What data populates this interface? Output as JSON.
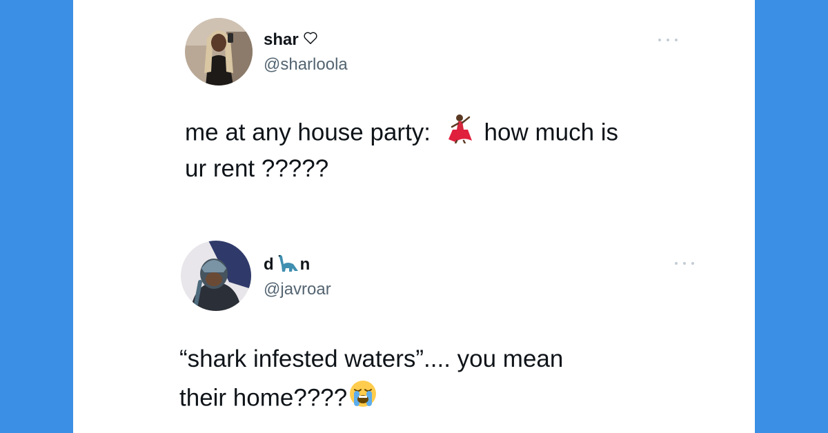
{
  "tweets": [
    {
      "display_name": "shar",
      "name_badge_icon": "heart-outline-icon",
      "handle": "@sharloola",
      "text_line1_before": "me at any house party:",
      "text_line1_emoji": "dancer-emoji",
      "text_line1_after": "how much is",
      "text_line2": "ur rent ?????"
    },
    {
      "display_name_start": "d",
      "display_name_emoji": "sauropod-emoji",
      "display_name_end": "n",
      "handle": "@javroar",
      "text_line1": "“shark infested waters”.... you mean",
      "text_line2_before": "their home????",
      "text_line2_emoji": "loudly-crying-face-emoji"
    }
  ],
  "colors": {
    "background": "#3b8fe4",
    "card": "#ffffff",
    "text": "#0f1419",
    "secondary_text": "#536471"
  }
}
